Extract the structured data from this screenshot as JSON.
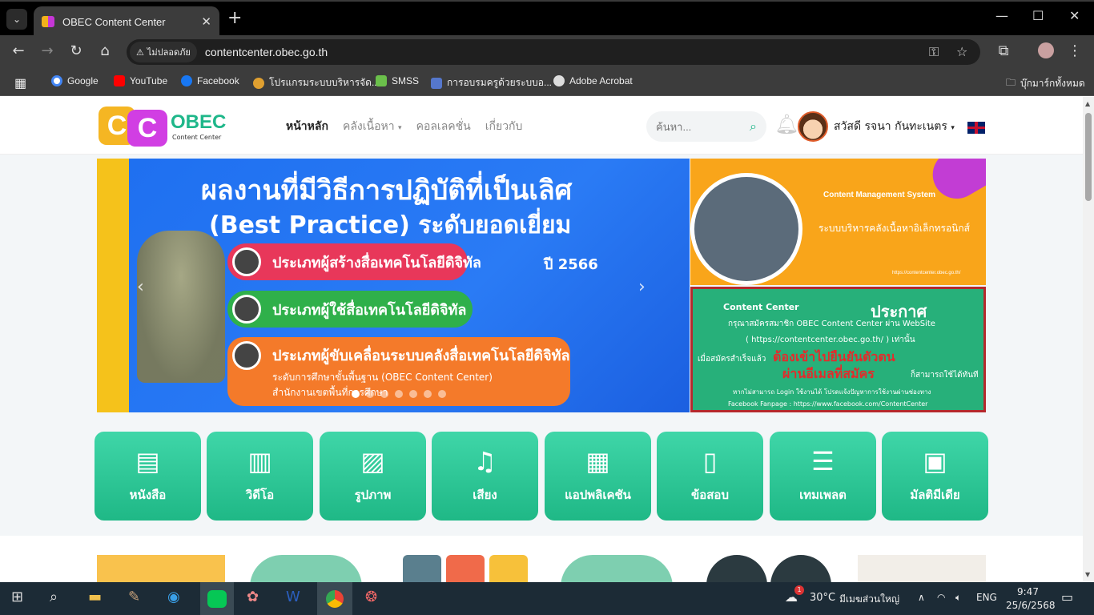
{
  "browser": {
    "tab_title": "OBEC Content Center",
    "new_tab": "+",
    "security_label": "ไม่ปลอดภัย",
    "url": "contentcenter.obec.go.th",
    "bookmarks": [
      "Google",
      "YouTube",
      "Facebook",
      "โปรแกรมระบบบริหารจัด...",
      "SMSS",
      "การอบรมครูด้วยระบบอ...",
      "Adobe Acrobat"
    ],
    "all_bookmarks": "บุ๊กมาร์กทั้งหมด"
  },
  "site": {
    "logo_obec": "OBEC",
    "logo_sub": "Content Center",
    "nav": [
      "หน้าหลัก",
      "คลังเนื้อหา",
      "คอลเลคชั่น",
      "เกี่ยวกับ"
    ],
    "search_placeholder": "ค้นหา...",
    "username": "สวัสดี รจนา กันทะเนตร",
    "language_flag": "uk-flag"
  },
  "banner": {
    "headline1": "ผลงานที่มีวิธีการปฏิบัติที่เป็นเลิศ",
    "headline2": "(Best Practice) ระดับยอดเยี่ยม",
    "year": "ปี 2566",
    "item1": "ประเภทผู้สร้างสื่อเทคโนโลยีดิจิทัล",
    "item2": "ประเภทผู้ใช้สื่อเทคโนโลยีดิจิทัล",
    "item3": "ประเภทผู้ขับเคลื่อนระบบคลังสื่อเทคโนโลยีดิจิทัล",
    "item3_sub1": "ระดับการศึกษาขั้นพื้นฐาน (OBEC Content Center)",
    "item3_sub2": "สำนักงานเขตพื้นที่การศึกษา",
    "slide_count": 7,
    "active_slide": 1,
    "side1_title": "Content Management System",
    "side1_sub": "ระบบบริหารคลังเนื้อหาอิเล็กทรอนิกส์",
    "side1_url": "https://contentcenter.obec.go.th/",
    "side2_brand": "Content Center",
    "side2_heading": "ประกาศ",
    "side2_line1": "กรุณาสมัครสมาชิก OBEC Content Center ผ่าน WebSite",
    "side2_line2": "( https://contentcenter.obec.go.th/ ) เท่านั้น",
    "side2_line3": "เมื่อสมัครสำเร็จแล้ว",
    "side2_red1": "ต้องเข้าไปยืนยันตัวตน",
    "side2_red2": "ผ่านอีเมลที่สมัคร",
    "side2_line4": "ก็สามารถใช้ได้ทันที",
    "side2_line5": "หากไม่สามารถ Login ใช้งานได้ โปรดแจ้งปัญหาการใช้งานผ่านช่องทาง",
    "side2_line6": "Facebook Fanpage : https://www.facebook.com/ContentCenter"
  },
  "categories": [
    {
      "label": "หนังสือ",
      "icon": "book-icon"
    },
    {
      "label": "วิดีโอ",
      "icon": "film-icon"
    },
    {
      "label": "รูปภาพ",
      "icon": "image-icon"
    },
    {
      "label": "เสียง",
      "icon": "music-icon"
    },
    {
      "label": "แอปพลิเคชัน",
      "icon": "apps-icon"
    },
    {
      "label": "ข้อสอบ",
      "icon": "document-icon"
    },
    {
      "label": "เทมเพลต",
      "icon": "list-icon"
    },
    {
      "label": "มัลติมีเดีย",
      "icon": "multimedia-icon"
    }
  ],
  "taskbar": {
    "weather": "30°C",
    "weather_desc": "มีเมฆส่วนใหญ่",
    "weather_badge": "1",
    "lang": "ENG",
    "time": "9:47",
    "date": "25/6/2568"
  },
  "colors": {
    "accent": "#1fb886",
    "brand_yellow": "#f5b623",
    "brand_purple": "#d13ee3"
  }
}
